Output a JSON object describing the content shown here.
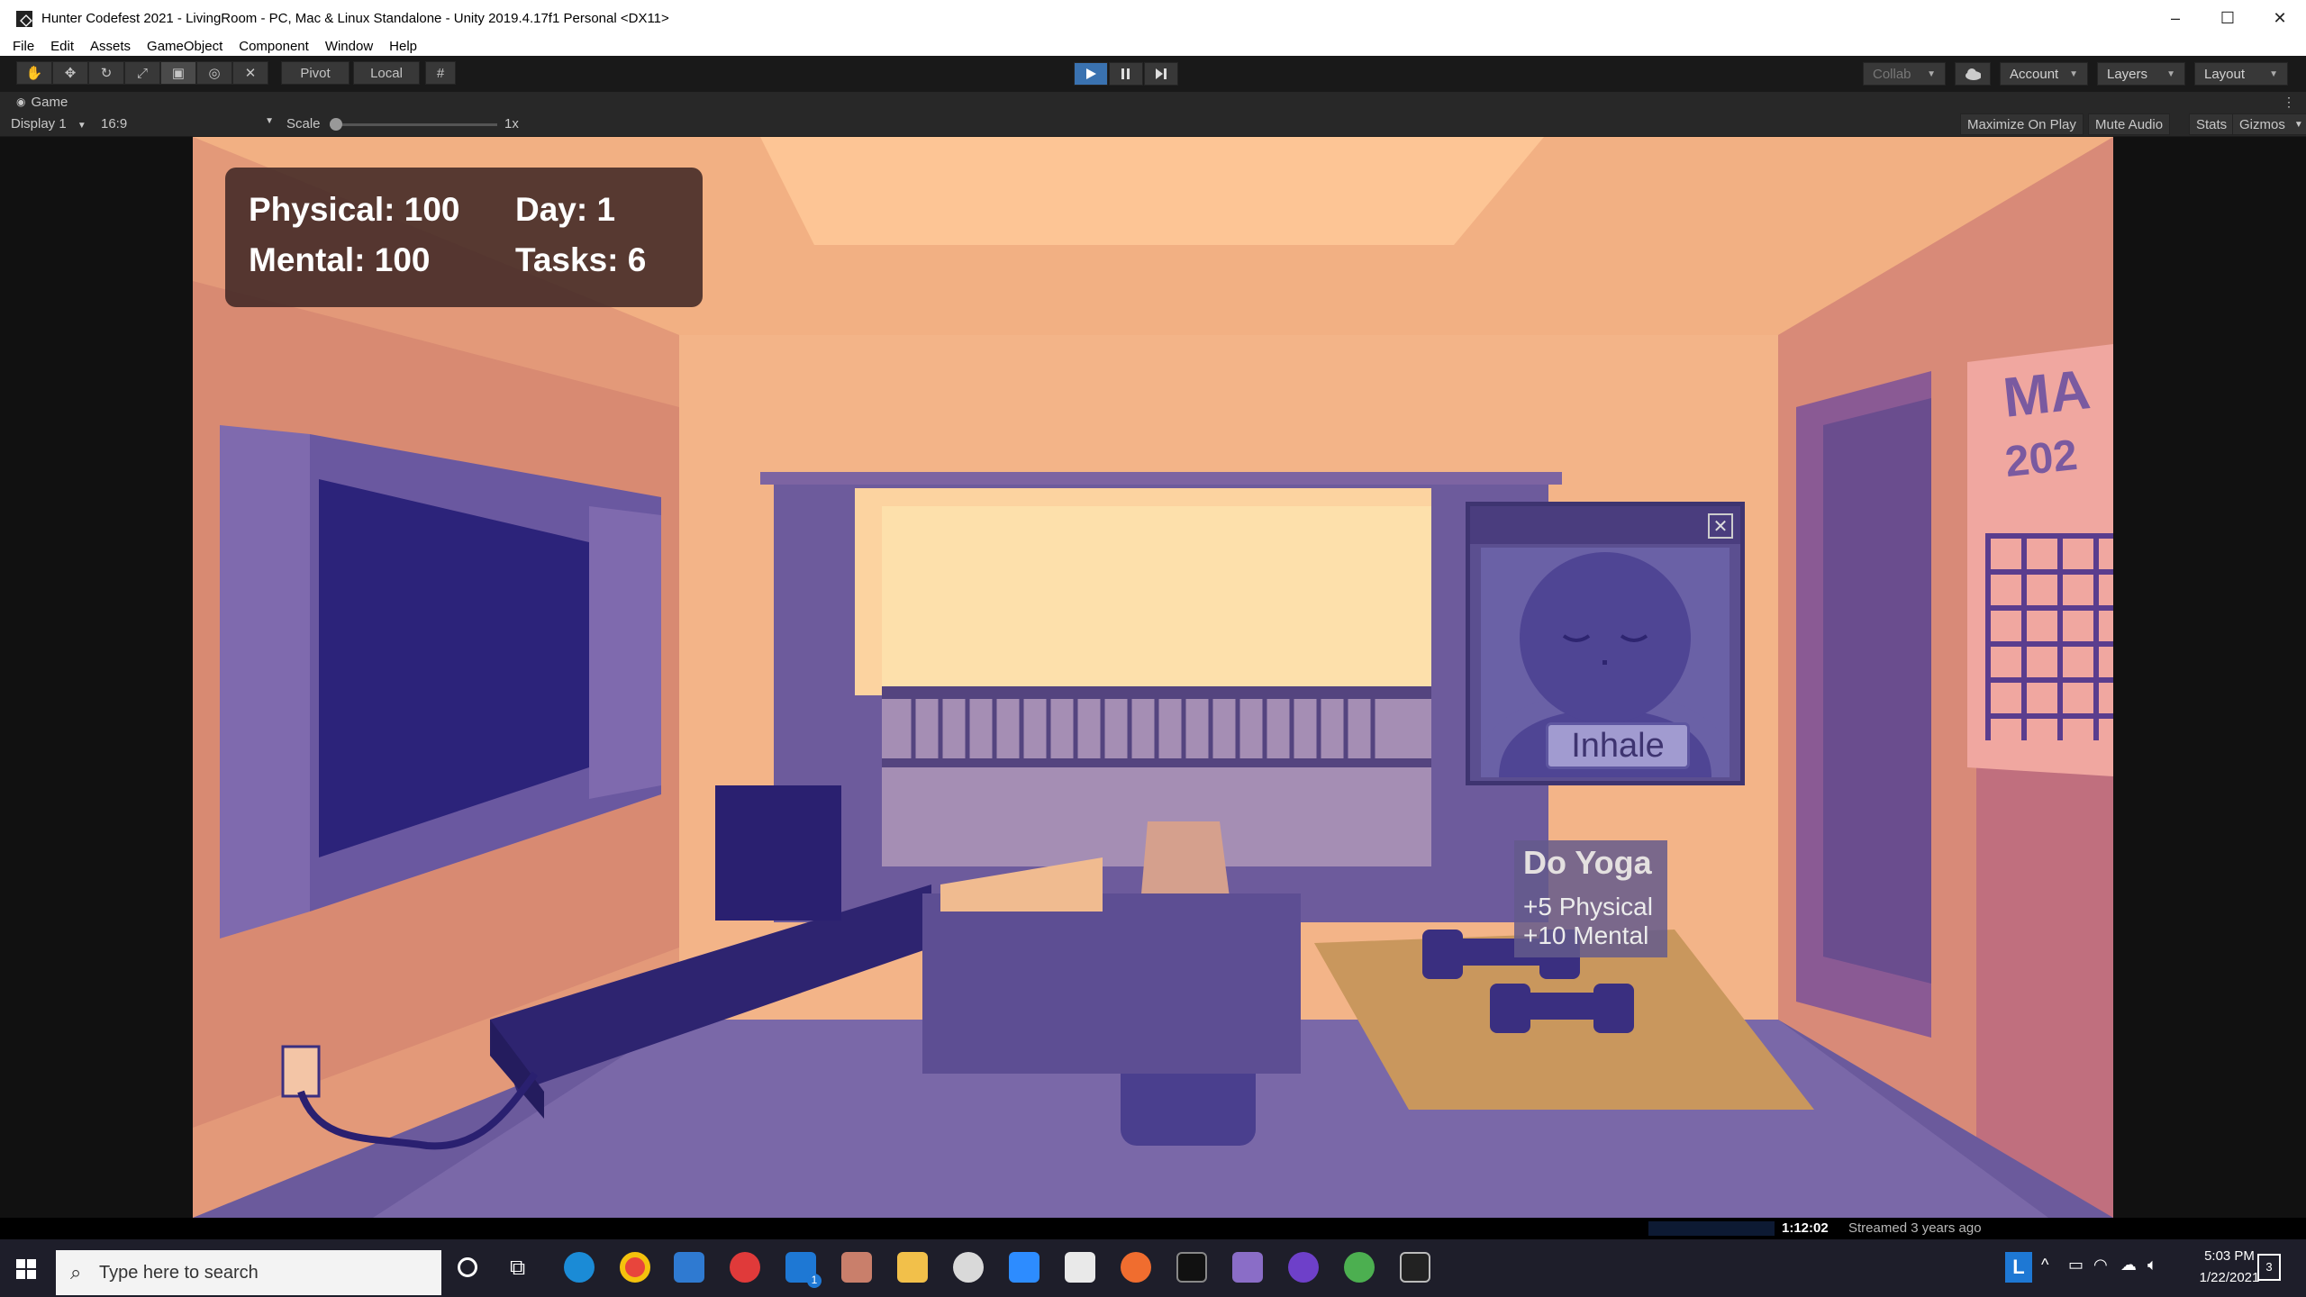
{
  "window": {
    "title": "Hunter Codefest 2021 - LivingRoom - PC, Mac & Linux Standalone - Unity 2019.4.17f1 Personal <DX11>",
    "minimize": "–",
    "maximize": "☐",
    "close": "✕"
  },
  "menu": [
    "File",
    "Edit",
    "Assets",
    "GameObject",
    "Component",
    "Window",
    "Help"
  ],
  "toolbar": {
    "pivot": "Pivot",
    "local": "Local",
    "collab": "Collab",
    "account": "Account",
    "layers": "Layers",
    "layout": "Layout"
  },
  "game_tab": {
    "label": "Game"
  },
  "game_bar": {
    "display": "Display 1",
    "aspect": "16:9",
    "scale_label": "Scale",
    "scale_value": "1x",
    "maximize_on_play": "Maximize On Play",
    "mute_audio": "Mute Audio",
    "stats": "Stats",
    "gizmos": "Gizmos"
  },
  "hud": {
    "physical": "Physical: 100",
    "day": "Day: 1",
    "mental": "Mental: 100",
    "tasks": "Tasks: 6"
  },
  "yoga_popup": {
    "button": "Inhale"
  },
  "tooltip": {
    "title": "Do Yoga",
    "line1": "+5 Physical",
    "line2": "+10 Mental"
  },
  "poster_text": "MA",
  "poster_year": "202",
  "stream": {
    "time": "1:12:02",
    "status": "Streamed 3 years ago"
  },
  "taskbar": {
    "search_placeholder": "Type here to search",
    "time": "5:03 PM",
    "date": "1/22/2021",
    "notif_count": "3",
    "mail_badge": "1"
  },
  "colors": {
    "play_active": "#3a72b0",
    "scene_wall": "#e3a27d",
    "scene_floor": "#6b5a9c"
  }
}
